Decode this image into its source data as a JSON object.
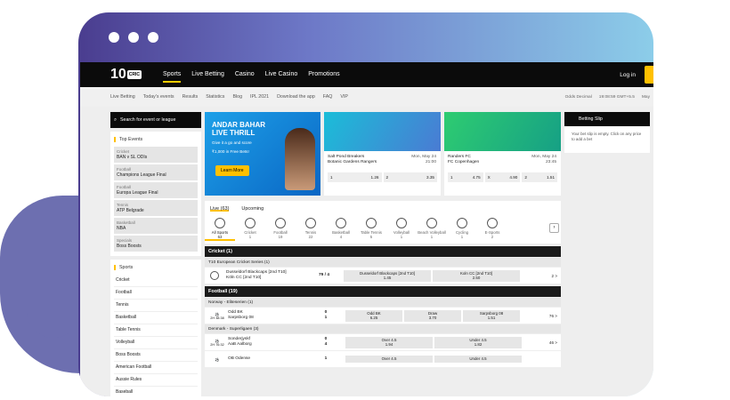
{
  "nav": {
    "items": [
      "Sports",
      "Live Betting",
      "Casino",
      "Live Casino",
      "Promotions"
    ],
    "login": "Log in"
  },
  "logo": {
    "one": "10",
    "cric": "CRIC"
  },
  "subnav": {
    "items": [
      "Live Betting",
      "Today's events",
      "Results",
      "Statistics",
      "Blog",
      "IPL 2021",
      "Download the app",
      "FAQ",
      "VIP"
    ],
    "odds": "Odds  Decimal",
    "clock": "19:08:59  GMT+5.5",
    "may": "May"
  },
  "search": {
    "placeholder": "Search for event or league"
  },
  "top_events": {
    "title": "Top Events",
    "items": [
      {
        "c": "Cricket",
        "n": "BAN v SL ODIs"
      },
      {
        "c": "Football",
        "n": "Champions League Final"
      },
      {
        "c": "Football",
        "n": "Europa League Final"
      },
      {
        "c": "Tennis",
        "n": "ATP Belgrade"
      },
      {
        "c": "Basketball",
        "n": "NBA"
      },
      {
        "c": "Specials",
        "n": "Boss Boosts"
      }
    ]
  },
  "sports": {
    "title": "Sports",
    "items": [
      "Cricket",
      "Football",
      "Tennis",
      "Basketball",
      "Table Tennis",
      "Volleyball",
      "Boss Boosts",
      "American Football",
      "Aussie Rules",
      "Baseball"
    ]
  },
  "promo": {
    "h1": "ANDAR BAHAR",
    "h2": "LIVE THRILL",
    "s1": "Give it a go and score",
    "s2": "₹1,000 in Free Bets!",
    "btn": "Learn More"
  },
  "banner1": {
    "t1": "Salt Pond Breakers",
    "t2": "Botanic Gardens Rangers",
    "d": "Mon, May 24",
    "time": "21:00",
    "o1l": "1",
    "o1": "1.26",
    "o2l": "2",
    "o2": "3.35"
  },
  "banner2": {
    "t1": "Randers FC",
    "t2": "FC Copenhagen",
    "d": "Mon, May 24",
    "time": "23:45",
    "o1l": "1",
    "o1": "4.75",
    "oxl": "X",
    "ox": "4.90",
    "o2l": "2",
    "o2": "1.51"
  },
  "tabs": {
    "live": "Live (63)",
    "upcoming": "Upcoming"
  },
  "sportbar": [
    {
      "n": "All Sports",
      "c": "63"
    },
    {
      "n": "Cricket",
      "c": "1"
    },
    {
      "n": "Football",
      "c": "19"
    },
    {
      "n": "Tennis",
      "c": "22"
    },
    {
      "n": "Basketball",
      "c": "4"
    },
    {
      "n": "Table Tennis",
      "c": "5"
    },
    {
      "n": "Volleyball",
      "c": "1"
    },
    {
      "n": "Beach Volleyball",
      "c": "1"
    },
    {
      "n": "Cycling",
      "c": "1"
    },
    {
      "n": "E-Sports",
      "c": "2"
    }
  ],
  "cricket": {
    "header": "Cricket (1)",
    "league": "T10 European Cricket Series (1)",
    "t1": "Dusseldorf Blackcaps [2nd T10]",
    "t2": "Köln CC [2nd T10]",
    "s1": "79 / 4",
    "c1a": "Dusseldorf Blackcaps [2nd T10]",
    "c1b": "1.45",
    "c2a": "Koln CC [2nd T10]",
    "c2b": "2.50",
    "more": "2 >"
  },
  "football": {
    "header": "Football (19)",
    "league1": "Norway - Eliteserien (1)",
    "r1": {
      "time": "2H 38:38",
      "t1": "Odd BK",
      "t2": "Sarpsborg 08",
      "s1": "0",
      "s2": "1",
      "c1a": "Odd BK",
      "c1b": "6.25",
      "c2a": "Draw",
      "c2b": "3.70",
      "c3a": "Sarpsborg 08",
      "c3b": "1.51",
      "more": "76 >"
    },
    "league2": "Denmark - Superligaen (3)",
    "r2": {
      "time": "2H 76:32",
      "t1": "Sonderjyskf",
      "t2": "AaB Aalborg",
      "s1": "0",
      "s2": "4",
      "c1a": "Over 4.5",
      "c1b": "1.94",
      "c2a": "Under 4.5",
      "c2b": "1.82",
      "more": "46 >"
    },
    "r3": {
      "t1": "OB Odense",
      "s1": "1",
      "c1a": "Over 4.5",
      "c2a": "Under 4.5"
    }
  },
  "betslip": {
    "title": "Betting Slip",
    "body": "Your bet slip is empty. Click on any price to add a bet"
  }
}
